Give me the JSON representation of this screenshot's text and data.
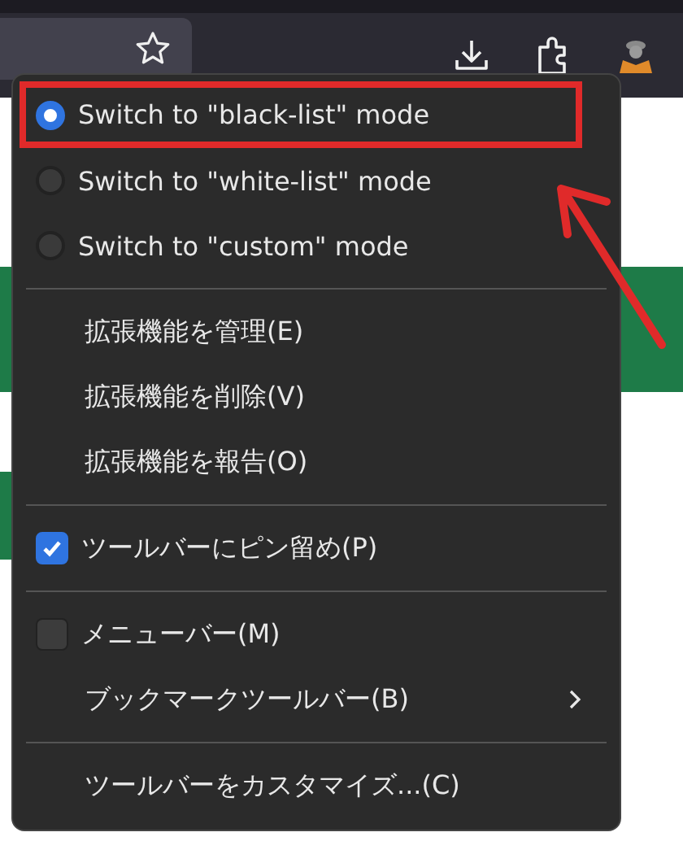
{
  "menu": {
    "items": [
      {
        "kind": "radio",
        "label": "Switch to \"black-list\" mode",
        "selected": true,
        "highlighted": true
      },
      {
        "kind": "radio",
        "label": "Switch to \"white-list\" mode",
        "selected": false,
        "highlighted": false
      },
      {
        "kind": "radio",
        "label": "Switch to \"custom\" mode",
        "selected": false,
        "highlighted": false
      },
      {
        "kind": "separator"
      },
      {
        "kind": "item",
        "label": "拡張機能を管理(E)"
      },
      {
        "kind": "item",
        "label": "拡張機能を削除(V)"
      },
      {
        "kind": "item",
        "label": "拡張機能を報告(O)"
      },
      {
        "kind": "separator"
      },
      {
        "kind": "checkbox",
        "label": "ツールバーにピン留め(P)",
        "checked": true
      },
      {
        "kind": "separator"
      },
      {
        "kind": "checkbox",
        "label": "メニューバー(M)",
        "checked": false
      },
      {
        "kind": "submenu",
        "label": "ブックマークツールバー(B)"
      },
      {
        "kind": "separator"
      },
      {
        "kind": "item",
        "label": "ツールバーをカスタマイズ...(C)"
      }
    ]
  }
}
